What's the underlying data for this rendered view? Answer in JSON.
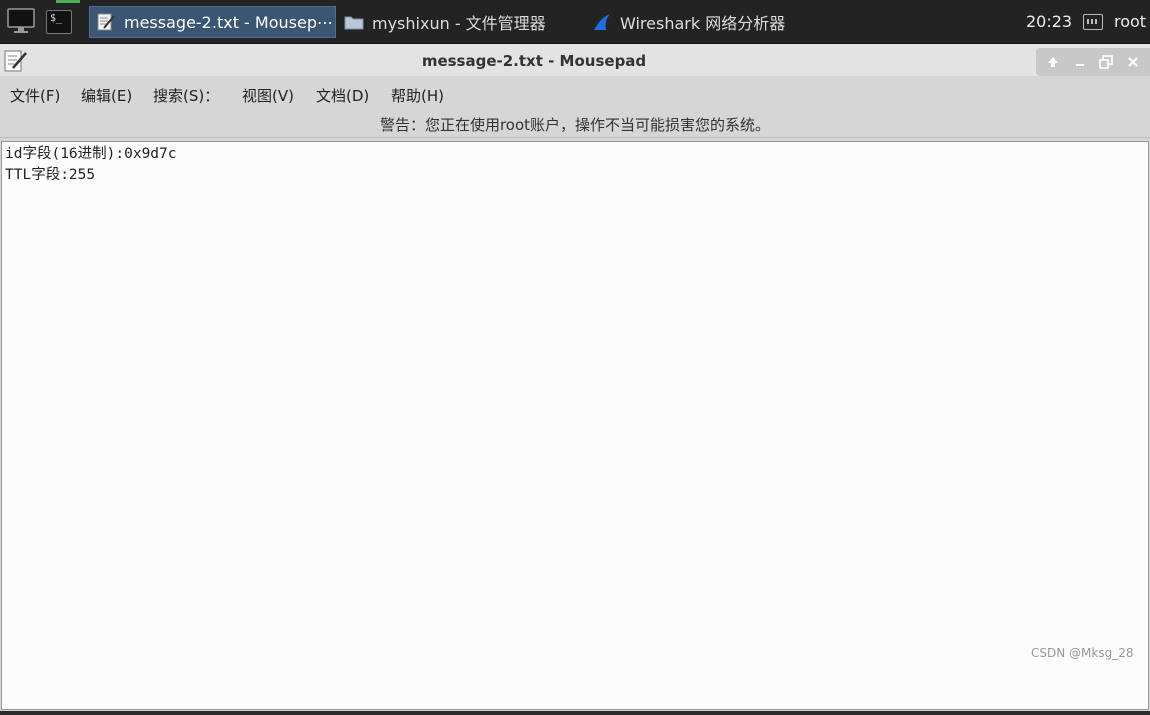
{
  "taskbar": {
    "tasks": [
      {
        "label": "message-2.txt - Mousep⋯",
        "icon": "text-editor-icon",
        "active": true
      },
      {
        "label": "myshixun - 文件管理器",
        "icon": "folder-icon",
        "active": false
      },
      {
        "label": "Wireshark 网络分析器",
        "icon": "wireshark-fin-icon",
        "active": false
      }
    ],
    "terminal_prompt": "$_",
    "clock": "20:23",
    "user": "root"
  },
  "window": {
    "title": "message-2.txt - Mousepad"
  },
  "menu": {
    "items": [
      "文件(F)",
      "编辑(E)",
      "搜索(S)：",
      "视图(V)",
      "文档(D)",
      "帮助(H)"
    ]
  },
  "warning": "警告：您正在使用root账户，操作不当可能损害您的系统。",
  "editor": {
    "lines": [
      "id字段(16进制):0x9d7c",
      "TTL字段:255"
    ]
  },
  "watermark": "CSDN @Mksg_28",
  "colors": {
    "taskbar_bg": "#232323",
    "active_task": "#3b5673",
    "window_bg": "#d6d6d6",
    "editor_bg": "#fcfcfc"
  }
}
